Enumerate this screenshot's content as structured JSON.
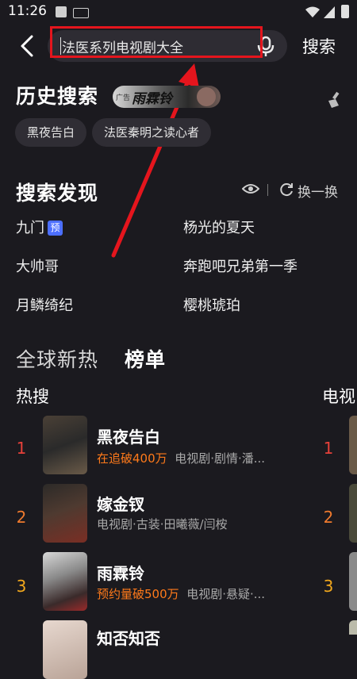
{
  "status_bar": {
    "time": "11:26"
  },
  "search": {
    "query": "法医系列电视剧大全",
    "search_button": "搜索"
  },
  "history": {
    "title": "历史搜索",
    "ad": {
      "label": "广告",
      "title": "雨霖铃"
    },
    "chips": [
      "黑夜告白",
      "法医秦明之读心者"
    ]
  },
  "discovery": {
    "title": "搜索发现",
    "refresh_label": "换一换",
    "items": [
      "九门",
      "杨光的夏天",
      "大帅哥",
      "奔跑吧兄弟第一季",
      "月鳞绮纪",
      "樱桃琥珀"
    ],
    "badge": "预"
  },
  "ranking": {
    "tabs": [
      "全球新热",
      "榜单"
    ],
    "list_title": "热搜",
    "second_column_title": "电视",
    "rows": [
      {
        "rank": "1",
        "title": "黑夜告白",
        "highlight": "在追破400万",
        "meta": "电视剧·剧情·潘..."
      },
      {
        "rank": "2",
        "title": "嫁金钗",
        "highlight": "",
        "meta": "电视剧·古装·田曦薇/闫桉"
      },
      {
        "rank": "3",
        "title": "雨霖铃",
        "highlight": "预约量破500万",
        "meta": "电视剧·悬疑·..."
      },
      {
        "rank": "",
        "title": "知否知否",
        "highlight": "",
        "meta": ""
      }
    ],
    "second_column_ranks": [
      "1",
      "2",
      "3"
    ]
  },
  "colors": {
    "background": "#1b1a1f",
    "accent_orange": "#ff7a1a",
    "rank1": "#e8413a",
    "rank2": "#f07a2e",
    "rank3": "#f2a81d",
    "annotation_red": "#e5151d"
  }
}
